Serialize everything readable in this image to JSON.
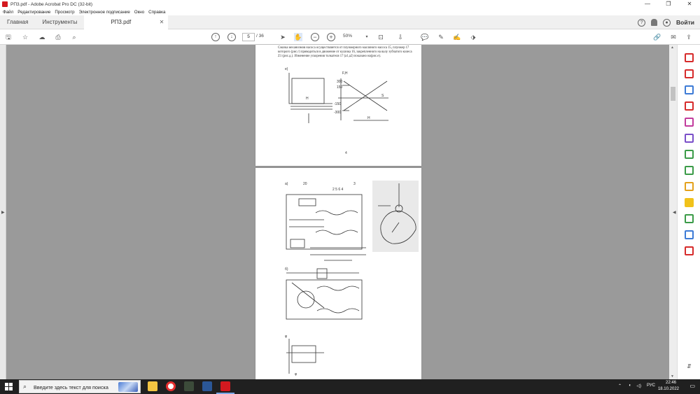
{
  "window": {
    "title": "РП3.pdf - Adobe Acrobat Pro DC (32-bit)"
  },
  "menu": [
    "Файл",
    "Редактирование",
    "Просмотр",
    "Электронное подписание",
    "Окно",
    "Справка"
  ],
  "tabs": {
    "home": "Главная",
    "tools": "Инструменты",
    "document": "РП3.pdf"
  },
  "header": {
    "login": "Войти"
  },
  "toolbar": {
    "page_current": "5",
    "page_total": "/ 36",
    "zoom": "50%"
  },
  "document": {
    "page1_text": "Смазка механизмов насоса осуществляется от плунжерного масляного насоса 15, плунжер 17 которого (рис.г) приводиться в движение от кулачка 16, закрепленного на валу зубчатого колеса Z1 (рис.д.). Изменение ускорения толкателя 17 (а1,а2) показано на(рис.е).",
    "page1_number": "4"
  },
  "taskbar": {
    "search_placeholder": "Введите здесь текст для поиска",
    "lang": "РУС",
    "time": "22:46",
    "date": "18.10.2022"
  }
}
